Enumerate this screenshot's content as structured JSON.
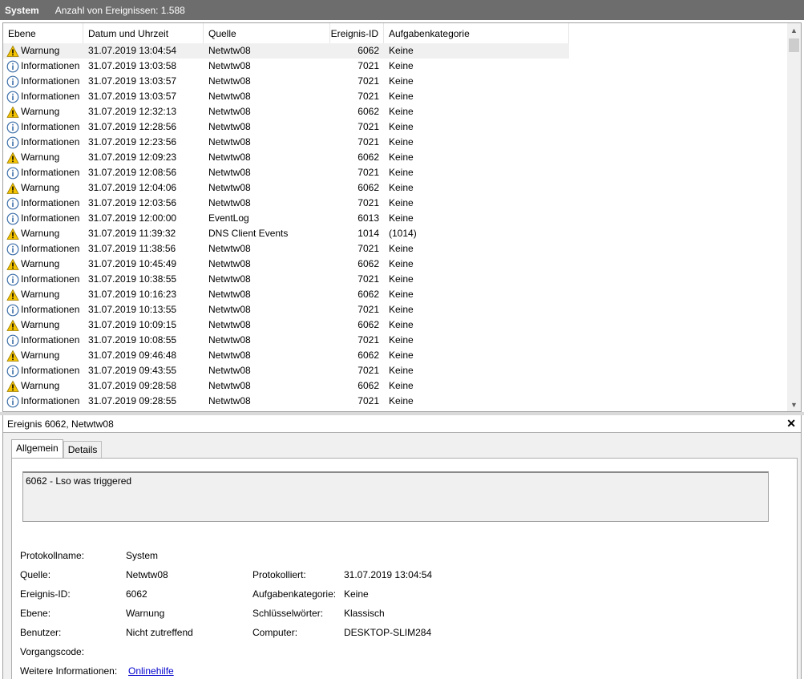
{
  "header": {
    "title": "System",
    "count_text": "Anzahl von Ereignissen: 1.588"
  },
  "columns": {
    "level": "Ebene",
    "date": "Datum und Uhrzeit",
    "source": "Quelle",
    "id": "Ereignis-ID",
    "category": "Aufgabenkategorie"
  },
  "events": [
    {
      "level": "Warnung",
      "icon": "warning-icon",
      "date": "31.07.2019 13:04:54",
      "source": "Netwtw08",
      "id": "6062",
      "category": "Keine"
    },
    {
      "level": "Informationen",
      "icon": "info-icon",
      "date": "31.07.2019 13:03:58",
      "source": "Netwtw08",
      "id": "7021",
      "category": "Keine"
    },
    {
      "level": "Informationen",
      "icon": "info-icon",
      "date": "31.07.2019 13:03:57",
      "source": "Netwtw08",
      "id": "7021",
      "category": "Keine"
    },
    {
      "level": "Informationen",
      "icon": "info-icon",
      "date": "31.07.2019 13:03:57",
      "source": "Netwtw08",
      "id": "7021",
      "category": "Keine"
    },
    {
      "level": "Warnung",
      "icon": "warning-icon",
      "date": "31.07.2019 12:32:13",
      "source": "Netwtw08",
      "id": "6062",
      "category": "Keine"
    },
    {
      "level": "Informationen",
      "icon": "info-icon",
      "date": "31.07.2019 12:28:56",
      "source": "Netwtw08",
      "id": "7021",
      "category": "Keine"
    },
    {
      "level": "Informationen",
      "icon": "info-icon",
      "date": "31.07.2019 12:23:56",
      "source": "Netwtw08",
      "id": "7021",
      "category": "Keine"
    },
    {
      "level": "Warnung",
      "icon": "warning-icon",
      "date": "31.07.2019 12:09:23",
      "source": "Netwtw08",
      "id": "6062",
      "category": "Keine"
    },
    {
      "level": "Informationen",
      "icon": "info-icon",
      "date": "31.07.2019 12:08:56",
      "source": "Netwtw08",
      "id": "7021",
      "category": "Keine"
    },
    {
      "level": "Warnung",
      "icon": "warning-icon",
      "date": "31.07.2019 12:04:06",
      "source": "Netwtw08",
      "id": "6062",
      "category": "Keine"
    },
    {
      "level": "Informationen",
      "icon": "info-icon",
      "date": "31.07.2019 12:03:56",
      "source": "Netwtw08",
      "id": "7021",
      "category": "Keine"
    },
    {
      "level": "Informationen",
      "icon": "info-icon",
      "date": "31.07.2019 12:00:00",
      "source": "EventLog",
      "id": "6013",
      "category": "Keine"
    },
    {
      "level": "Warnung",
      "icon": "warning-icon",
      "date": "31.07.2019 11:39:32",
      "source": "DNS Client Events",
      "id": "1014",
      "category": "(1014)"
    },
    {
      "level": "Informationen",
      "icon": "info-icon",
      "date": "31.07.2019 11:38:56",
      "source": "Netwtw08",
      "id": "7021",
      "category": "Keine"
    },
    {
      "level": "Warnung",
      "icon": "warning-icon",
      "date": "31.07.2019 10:45:49",
      "source": "Netwtw08",
      "id": "6062",
      "category": "Keine"
    },
    {
      "level": "Informationen",
      "icon": "info-icon",
      "date": "31.07.2019 10:38:55",
      "source": "Netwtw08",
      "id": "7021",
      "category": "Keine"
    },
    {
      "level": "Warnung",
      "icon": "warning-icon",
      "date": "31.07.2019 10:16:23",
      "source": "Netwtw08",
      "id": "6062",
      "category": "Keine"
    },
    {
      "level": "Informationen",
      "icon": "info-icon",
      "date": "31.07.2019 10:13:55",
      "source": "Netwtw08",
      "id": "7021",
      "category": "Keine"
    },
    {
      "level": "Warnung",
      "icon": "warning-icon",
      "date": "31.07.2019 10:09:15",
      "source": "Netwtw08",
      "id": "6062",
      "category": "Keine"
    },
    {
      "level": "Informationen",
      "icon": "info-icon",
      "date": "31.07.2019 10:08:55",
      "source": "Netwtw08",
      "id": "7021",
      "category": "Keine"
    },
    {
      "level": "Warnung",
      "icon": "warning-icon",
      "date": "31.07.2019 09:46:48",
      "source": "Netwtw08",
      "id": "6062",
      "category": "Keine"
    },
    {
      "level": "Informationen",
      "icon": "info-icon",
      "date": "31.07.2019 09:43:55",
      "source": "Netwtw08",
      "id": "7021",
      "category": "Keine"
    },
    {
      "level": "Warnung",
      "icon": "warning-icon",
      "date": "31.07.2019 09:28:58",
      "source": "Netwtw08",
      "id": "6062",
      "category": "Keine"
    },
    {
      "level": "Informationen",
      "icon": "info-icon",
      "date": "31.07.2019 09:28:55",
      "source": "Netwtw08",
      "id": "7021",
      "category": "Keine"
    }
  ],
  "detail": {
    "title": "Ereignis 6062, Netwtw08",
    "tabs": {
      "general": "Allgemein",
      "details": "Details"
    },
    "description": "6062 - Lso was triggered",
    "labels": {
      "log_name": "Protokollname:",
      "source": "Quelle:",
      "event_id": "Ereignis-ID:",
      "level": "Ebene:",
      "user": "Benutzer:",
      "opcode": "Vorgangscode:",
      "more_info": "Weitere Informationen:",
      "logged": "Protokolliert:",
      "task_category": "Aufgabenkategorie:",
      "keywords": "Schlüsselwörter:",
      "computer": "Computer:"
    },
    "values": {
      "log_name": "System",
      "source": "Netwtw08",
      "event_id": "6062",
      "level": "Warnung",
      "user": "Nicht zutreffend",
      "opcode": "",
      "more_info_link": "Onlinehilfe",
      "logged": "31.07.2019 13:04:54",
      "task_category": "Keine",
      "keywords": "Klassisch",
      "computer": "DESKTOP-SLIM284"
    }
  },
  "colors": {
    "header_bg": "#6d6d6d",
    "selected_row": "#f0f0f0",
    "link": "#0000cc",
    "warning": "#f5c400",
    "info": "#3c6ea8"
  }
}
